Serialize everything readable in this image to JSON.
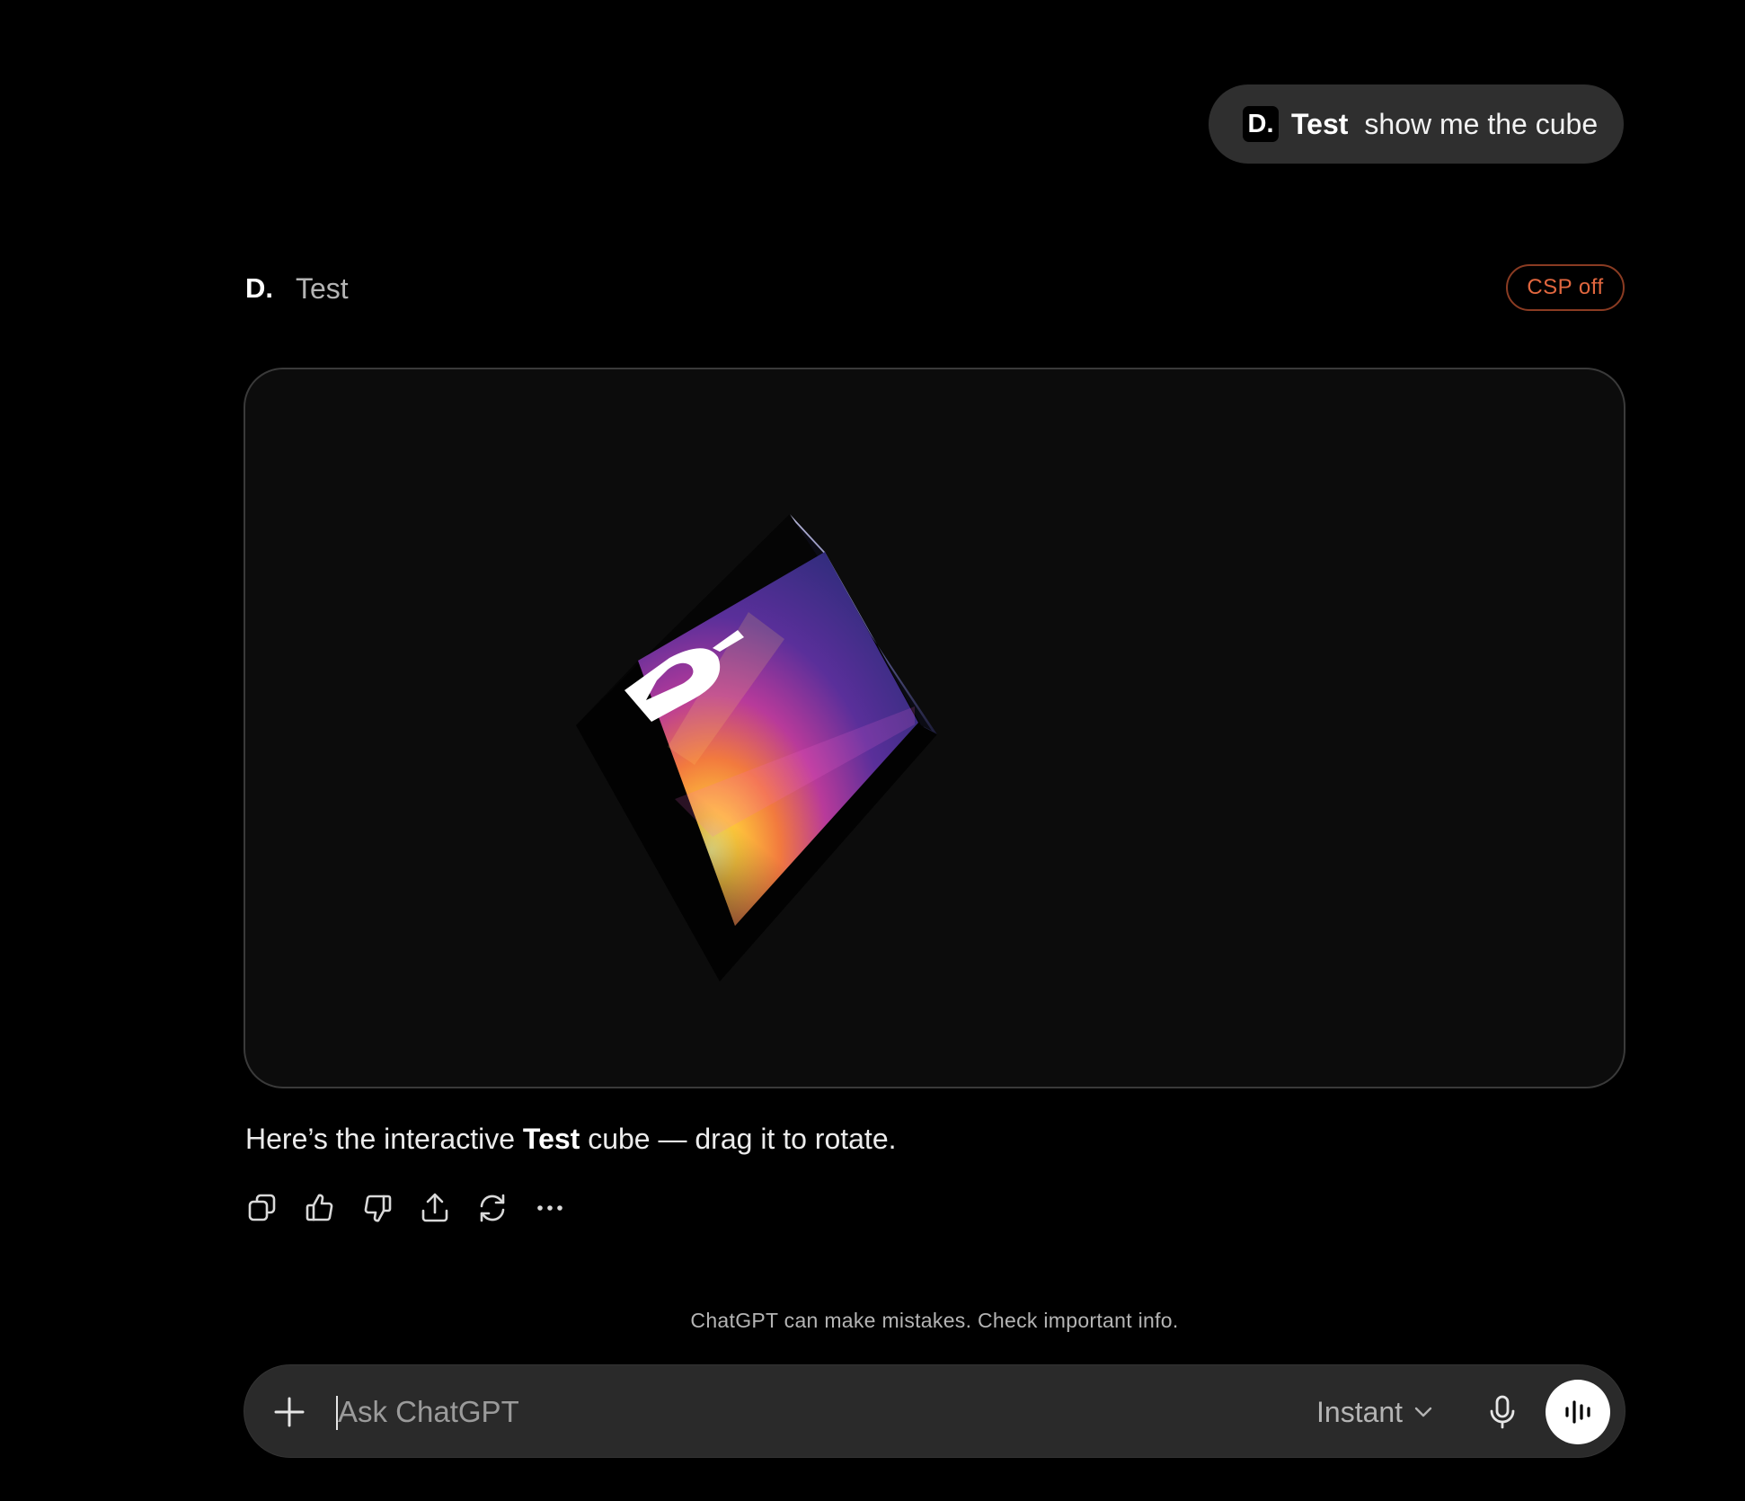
{
  "user_message": {
    "app_icon_letter": "D.",
    "app_name": "Test",
    "text": "show me the cube"
  },
  "app_header": {
    "logo": "D.",
    "name": "Test",
    "badge": "CSP off"
  },
  "widget": {
    "cube_face_letter": "D.",
    "icons": [
      "cube-icon"
    ]
  },
  "assistant_reply": {
    "prefix": "Here’s the interactive ",
    "bold": "Test",
    "suffix": " cube — drag it to rotate."
  },
  "actions": [
    "copy-icon",
    "thumbs-up-icon",
    "thumbs-down-icon",
    "share-icon",
    "regenerate-icon",
    "more-icon"
  ],
  "disclaimer": "ChatGPT can make mistakes. Check important info.",
  "composer": {
    "placeholder": "Ask ChatGPT",
    "value": "",
    "model": "Instant"
  },
  "colors": {
    "background": "#000000",
    "bubble": "#2f2f2f",
    "widget_bg": "#0c0c0c",
    "badge_text": "#e2673f",
    "badge_border": "#8a3b22",
    "composer_bg": "#2a2a2a"
  }
}
